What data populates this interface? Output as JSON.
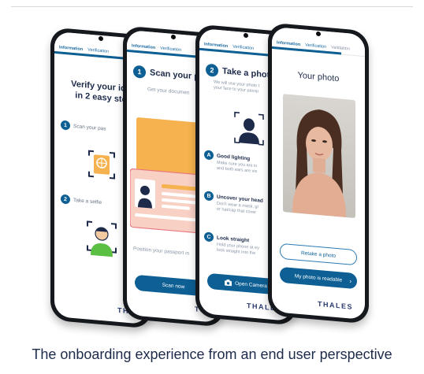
{
  "caption": "The onboarding experience from an end user perspective",
  "brand": "THALES",
  "tabs": {
    "information": "Information",
    "verification": "Verification",
    "validation": "Validation"
  },
  "phone1": {
    "title_line1": "Verify your ide",
    "title_line2": "in 2 easy ste",
    "step1_num": "1",
    "step1_label": "Scan your pas",
    "step2_num": "2",
    "step2_label": "Take a selfie"
  },
  "phone2": {
    "step_num": "1",
    "title": "Scan your pass",
    "subtitle": "Get your documen",
    "hint": "Position your passport in",
    "button": "Scan now"
  },
  "phone3": {
    "step_num": "2",
    "title": "Take a photo",
    "intro_line1": "We will use your photo t",
    "intro_line2": "your face to your passp",
    "items": [
      {
        "key": "A",
        "title": "Good lighting",
        "line1": "Make sure you are in",
        "line2": "and both ears are vis"
      },
      {
        "key": "B",
        "title": "Uncover your head",
        "line1": "Don't wear a mask, gl",
        "line2": "or hat/cap that cover"
      },
      {
        "key": "C",
        "title": "Look straight",
        "line1": "Hold your phone at ey",
        "line2": "look straight into the"
      }
    ],
    "button": "Open Camera"
  },
  "phone4": {
    "title": "Your photo",
    "retake": "Retake a photo",
    "confirm": "My photo is readable"
  },
  "colors": {
    "primary": "#0d5f94",
    "text": "#1d2a4a",
    "id_card": "#f6b24e",
    "avatar_green": "#5bbf43"
  }
}
